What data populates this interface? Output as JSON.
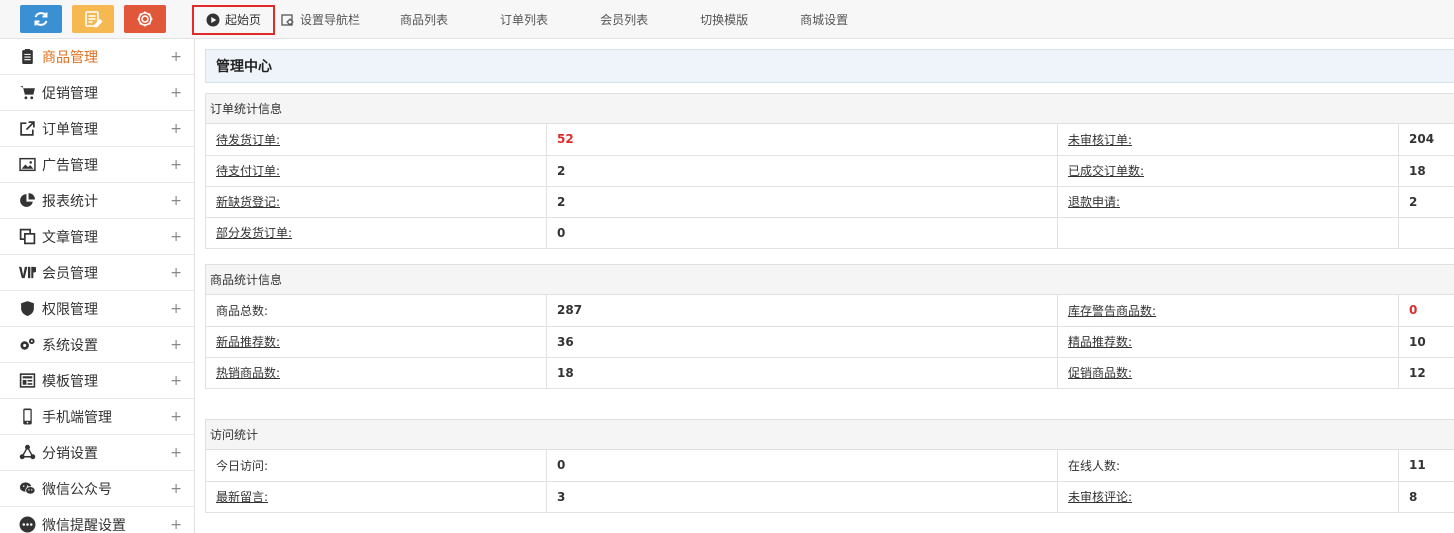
{
  "topbar": {
    "quick_buttons": [
      {
        "icon": "refresh-icon",
        "color": "#3b8fd3"
      },
      {
        "icon": "edit-note-icon",
        "color": "#f6b850"
      },
      {
        "icon": "gear-icon",
        "color": "#e0573a"
      }
    ],
    "nav": {
      "home": "起始页",
      "set_nav": "设置导航栏",
      "items": [
        "商品列表",
        "订单列表",
        "会员列表",
        "切换模版",
        "商城设置"
      ]
    }
  },
  "sidebar": {
    "items": [
      {
        "label": "商品管理",
        "icon": "clipboard-icon",
        "active": true
      },
      {
        "label": "促销管理",
        "icon": "cart-icon"
      },
      {
        "label": "订单管理",
        "icon": "external-link-icon"
      },
      {
        "label": "广告管理",
        "icon": "image-icon"
      },
      {
        "label": "报表统计",
        "icon": "pie-chart-icon"
      },
      {
        "label": "文章管理",
        "icon": "copy-icon"
      },
      {
        "label": "会员管理",
        "icon": "vip-icon"
      },
      {
        "label": "权限管理",
        "icon": "shield-icon"
      },
      {
        "label": "系统设置",
        "icon": "gears-icon"
      },
      {
        "label": "模板管理",
        "icon": "template-icon"
      },
      {
        "label": "手机端管理",
        "icon": "mobile-icon"
      },
      {
        "label": "分销设置",
        "icon": "share-icon"
      },
      {
        "label": "微信公众号",
        "icon": "wechat-icon"
      },
      {
        "label": "微信提醒设置",
        "icon": "chat-dots-icon"
      }
    ],
    "plus": "+"
  },
  "main": {
    "title": "管理中心",
    "order_stats": {
      "title": "订单统计信息",
      "rows": [
        {
          "l1": "待发货订单:",
          "v1": "52",
          "l2": "未审核订单:",
          "v2": "204"
        },
        {
          "l1": "待支付订单:",
          "v1": "2",
          "l2": "已成交订单数:",
          "v2": "18"
        },
        {
          "l1": "新缺货登记:",
          "v1": "2",
          "l2": "退款申请:",
          "v2": "2"
        },
        {
          "l1": "部分发货订单:",
          "v1": "0",
          "l2": "",
          "v2": ""
        }
      ]
    },
    "goods_stats": {
      "title": "商品统计信息",
      "rows": [
        {
          "l1": "商品总数:",
          "v1": "287",
          "l2": "库存警告商品数:",
          "v2": "0"
        },
        {
          "l1": "新品推荐数:",
          "v1": "36",
          "l2": "精品推荐数:",
          "v2": "10"
        },
        {
          "l1": "热销商品数:",
          "v1": "18",
          "l2": "促销商品数:",
          "v2": "12"
        }
      ]
    },
    "visit_stats": {
      "title": "访问统计",
      "rows": [
        {
          "l1": "今日访问:",
          "v1": "0",
          "l2": "在线人数:",
          "v2": "11"
        },
        {
          "l1": "最新留言:",
          "v1": "3",
          "l2": "未审核评论:",
          "v2": "8"
        }
      ]
    }
  },
  "colors": {
    "accent_orange": "#e0701e",
    "alert_red": "#e02b2b",
    "home_border": "#e02b2b"
  }
}
